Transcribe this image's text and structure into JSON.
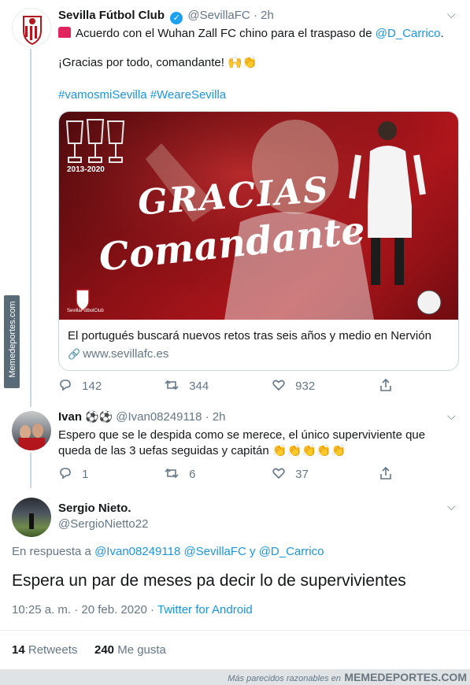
{
  "tweet1": {
    "name": "Sevilla Fútbol Club",
    "handle": "@SevillaFC",
    "time": "· 2h",
    "line1_prefix": "Acuerdo con el Wuhan Zall FC chino para el traspaso de",
    "line1_mention": "@D_Carrico",
    "line1_suffix": ".",
    "line2": "¡Gracias por todo, comandante!",
    "line2_emoji": "🙌👏",
    "hashtags": "#vamosmiSevilla #WeareSevilla",
    "card": {
      "years": "2013-2020",
      "title1": "GRACIAS",
      "title2": "Comandante",
      "badge_text": "SevillaFútbolClub",
      "caption": "El portugués buscará nuevos retos tras seis años y medio en Nervión",
      "url": "www.sevillafc.es"
    },
    "actions": {
      "replies": "142",
      "retweets": "344",
      "likes": "932"
    }
  },
  "tweet2": {
    "name": "Ivan",
    "name_emoji": "⚽⚽",
    "handle": "@Ivan08249118",
    "time": "· 2h",
    "line1": "Espero que se le despida como se merece, el único superviviente que",
    "line2": "queda de las 3 uefas seguidas y capitán",
    "line2_emoji": "👏👏👏👏👏",
    "actions": {
      "replies": "1",
      "retweets": "6",
      "likes": "37"
    }
  },
  "tweet3": {
    "name": "Sergio Nieto.",
    "handle": "@SergioNietto22",
    "reply_prefix": "En respuesta a",
    "reply_mentions": "@Ivan08249118 @SevillaFC y @D_Carrico",
    "text": "Espera un par de meses pa decir lo de supervivientes",
    "timestamp": "10:25 a. m. · 20 feb. 2020 ·",
    "source": "Twitter for Android",
    "retweets_count": "14",
    "retweets_label": "Retweets",
    "likes_count": "240",
    "likes_label": "Me gusta"
  },
  "watermark": {
    "side": "Memedeportes.com",
    "footer_prefix": "Más parecidos razonables en",
    "footer_brand": "MEMEDEPORTES.COM"
  },
  "colors": {
    "link": "#1b95e0",
    "secondary": "#657786",
    "sevilla_red": "#b3161c"
  },
  "icons": [
    "sevilla-crest-icon",
    "verified-icon",
    "siren-icon",
    "chevron-down-icon",
    "reply-icon",
    "retweet-icon",
    "like-icon",
    "share-icon",
    "link-icon"
  ]
}
